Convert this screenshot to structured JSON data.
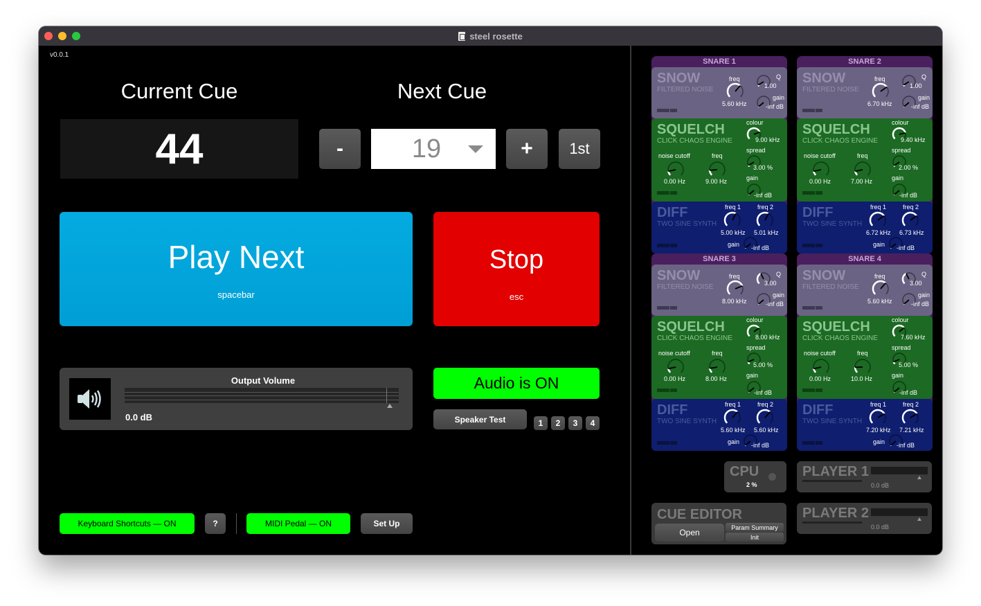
{
  "window": {
    "title": "steel rosette",
    "version": "v0.0.1"
  },
  "cues": {
    "current_label": "Current Cue",
    "current_value": "44",
    "next_label": "Next Cue",
    "next_value": "19",
    "minus_label": "-",
    "plus_label": "+",
    "first_label": "1st"
  },
  "transport": {
    "play_label": "Play Next",
    "play_shortcut": "spacebar",
    "stop_label": "Stop",
    "stop_shortcut": "esc",
    "play_color": "#04abe0",
    "stop_color": "#e20000"
  },
  "output": {
    "title": "Output Volume",
    "db": "0.0 dB",
    "icon": "speaker-icon"
  },
  "audio": {
    "status_label": "Audio is ON",
    "speaker_test_label": "Speaker Test",
    "speakers": [
      "1",
      "2",
      "3",
      "4"
    ],
    "on_color": "#00ff00"
  },
  "footer": {
    "keyboard_label": "Keyboard Shortcuts — ON",
    "help_label": "?",
    "midi_label": "MIDI Pedal — ON",
    "setup_label": "Set Up"
  },
  "snares": [
    {
      "title": "SNARE 1",
      "snow": {
        "name": "SNOW",
        "sub": "FILTERED NOISE",
        "freq_label": "freq",
        "freq": "5.60 kHz",
        "q_label": "Q",
        "q": "1.00",
        "gain_label": "gain",
        "gain": "-inf dB"
      },
      "squelch": {
        "name": "SQUELCH",
        "sub": "CLICK CHAOS ENGINE",
        "colour_label": "colour",
        "colour": "9.00 kHz",
        "spread_label": "spread",
        "spread": "3.00 %",
        "gain_label": "gain",
        "gain": "-inf dB",
        "cutoff_label": "noise cutoff",
        "cutoff": "0.00 Hz",
        "freq_label": "freq",
        "freq": "9.00 Hz"
      },
      "diff": {
        "name": "DIFF",
        "sub": "TWO SINE SYNTH",
        "freq1_label": "freq 1",
        "freq1": "5.00 kHz",
        "freq2_label": "freq 2",
        "freq2": "5.01 kHz",
        "gain_label": "gain",
        "gain": "-inf dB"
      }
    },
    {
      "title": "SNARE 2",
      "snow": {
        "name": "SNOW",
        "sub": "FILTERED NOISE",
        "freq_label": "freq",
        "freq": "6.70 kHz",
        "q_label": "Q",
        "q": "1.00",
        "gain_label": "gain",
        "gain": "-inf dB"
      },
      "squelch": {
        "name": "SQUELCH",
        "sub": "CLICK CHAOS ENGINE",
        "colour_label": "colour",
        "colour": "9.40 kHz",
        "spread_label": "spread",
        "spread": "2.00 %",
        "gain_label": "gain",
        "gain": "-inf dB",
        "cutoff_label": "noise cutoff",
        "cutoff": "0.00 Hz",
        "freq_label": "freq",
        "freq": "7.00 Hz"
      },
      "diff": {
        "name": "DIFF",
        "sub": "TWO SINE SYNTH",
        "freq1_label": "freq 1",
        "freq1": "6.72 kHz",
        "freq2_label": "freq 2",
        "freq2": "6.73 kHz",
        "gain_label": "gain",
        "gain": "-inf dB"
      }
    },
    {
      "title": "SNARE 3",
      "snow": {
        "name": "SNOW",
        "sub": "FILTERED NOISE",
        "freq_label": "freq",
        "freq": "8.00 kHz",
        "q_label": "Q",
        "q": "3.00",
        "gain_label": "gain",
        "gain": "-inf dB"
      },
      "squelch": {
        "name": "SQUELCH",
        "sub": "CLICK CHAOS ENGINE",
        "colour_label": "colour",
        "colour": "8.00 kHz",
        "spread_label": "spread",
        "spread": "5.00 %",
        "gain_label": "gain",
        "gain": "-inf dB",
        "cutoff_label": "noise cutoff",
        "cutoff": "0.00 Hz",
        "freq_label": "freq",
        "freq": "8.00 Hz"
      },
      "diff": {
        "name": "DIFF",
        "sub": "TWO SINE SYNTH",
        "freq1_label": "freq 1",
        "freq1": "5.60 kHz",
        "freq2_label": "freq 2",
        "freq2": "5.60 kHz",
        "gain_label": "gain",
        "gain": "-inf dB"
      }
    },
    {
      "title": "SNARE 4",
      "snow": {
        "name": "SNOW",
        "sub": "FILTERED NOISE",
        "freq_label": "freq",
        "freq": "5.60 kHz",
        "q_label": "Q",
        "q": "3.00",
        "gain_label": "gain",
        "gain": "-inf dB"
      },
      "squelch": {
        "name": "SQUELCH",
        "sub": "CLICK CHAOS ENGINE",
        "colour_label": "colour",
        "colour": "7.60 kHz",
        "spread_label": "spread",
        "spread": "5.00 %",
        "gain_label": "gain",
        "gain": "-inf dB",
        "cutoff_label": "noise cutoff",
        "cutoff": "0.00 Hz",
        "freq_label": "freq",
        "freq": "10.0 Hz"
      },
      "diff": {
        "name": "DIFF",
        "sub": "TWO SINE SYNTH",
        "freq1_label": "freq 1",
        "freq1": "7.20 kHz",
        "freq2_label": "freq 2",
        "freq2": "7.21 kHz",
        "gain_label": "gain",
        "gain": "-inf dB"
      }
    }
  ],
  "cpu": {
    "title": "CPU",
    "value": "2 %"
  },
  "players": [
    {
      "title": "PLAYER 1",
      "db": "0.0 dB"
    },
    {
      "title": "PLAYER 2",
      "db": "0.0 dB"
    }
  ],
  "cue_editor": {
    "title": "CUE EDITOR",
    "open_label": "Open",
    "param_summary_label": "Param Summary",
    "init_label": "Init"
  }
}
